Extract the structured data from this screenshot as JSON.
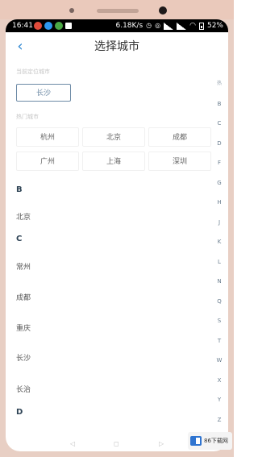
{
  "status_bar": {
    "time": "16:41",
    "speed": "6.18K/s",
    "battery": "52%"
  },
  "header": {
    "title": "选择城市"
  },
  "location": {
    "label": "当前定位城市",
    "city": "长沙"
  },
  "hot": {
    "label": "热门城市",
    "cities": [
      "杭州",
      "北京",
      "成都",
      "广州",
      "上海",
      "深圳"
    ]
  },
  "groups": [
    {
      "letter": "B",
      "cities": [
        "北京"
      ]
    },
    {
      "letter": "C",
      "cities": [
        "常州",
        "成都",
        "重庆",
        "长沙",
        "长治"
      ]
    },
    {
      "letter": "D",
      "cities": []
    }
  ],
  "index_bar": [
    "热",
    "B",
    "C",
    "D",
    "F",
    "G",
    "H",
    "J",
    "K",
    "L",
    "N",
    "Q",
    "S",
    "T",
    "W",
    "X",
    "Y",
    "Z"
  ],
  "navkeys": [
    "◁",
    "◻",
    "▷"
  ],
  "watermark": "86下载网"
}
